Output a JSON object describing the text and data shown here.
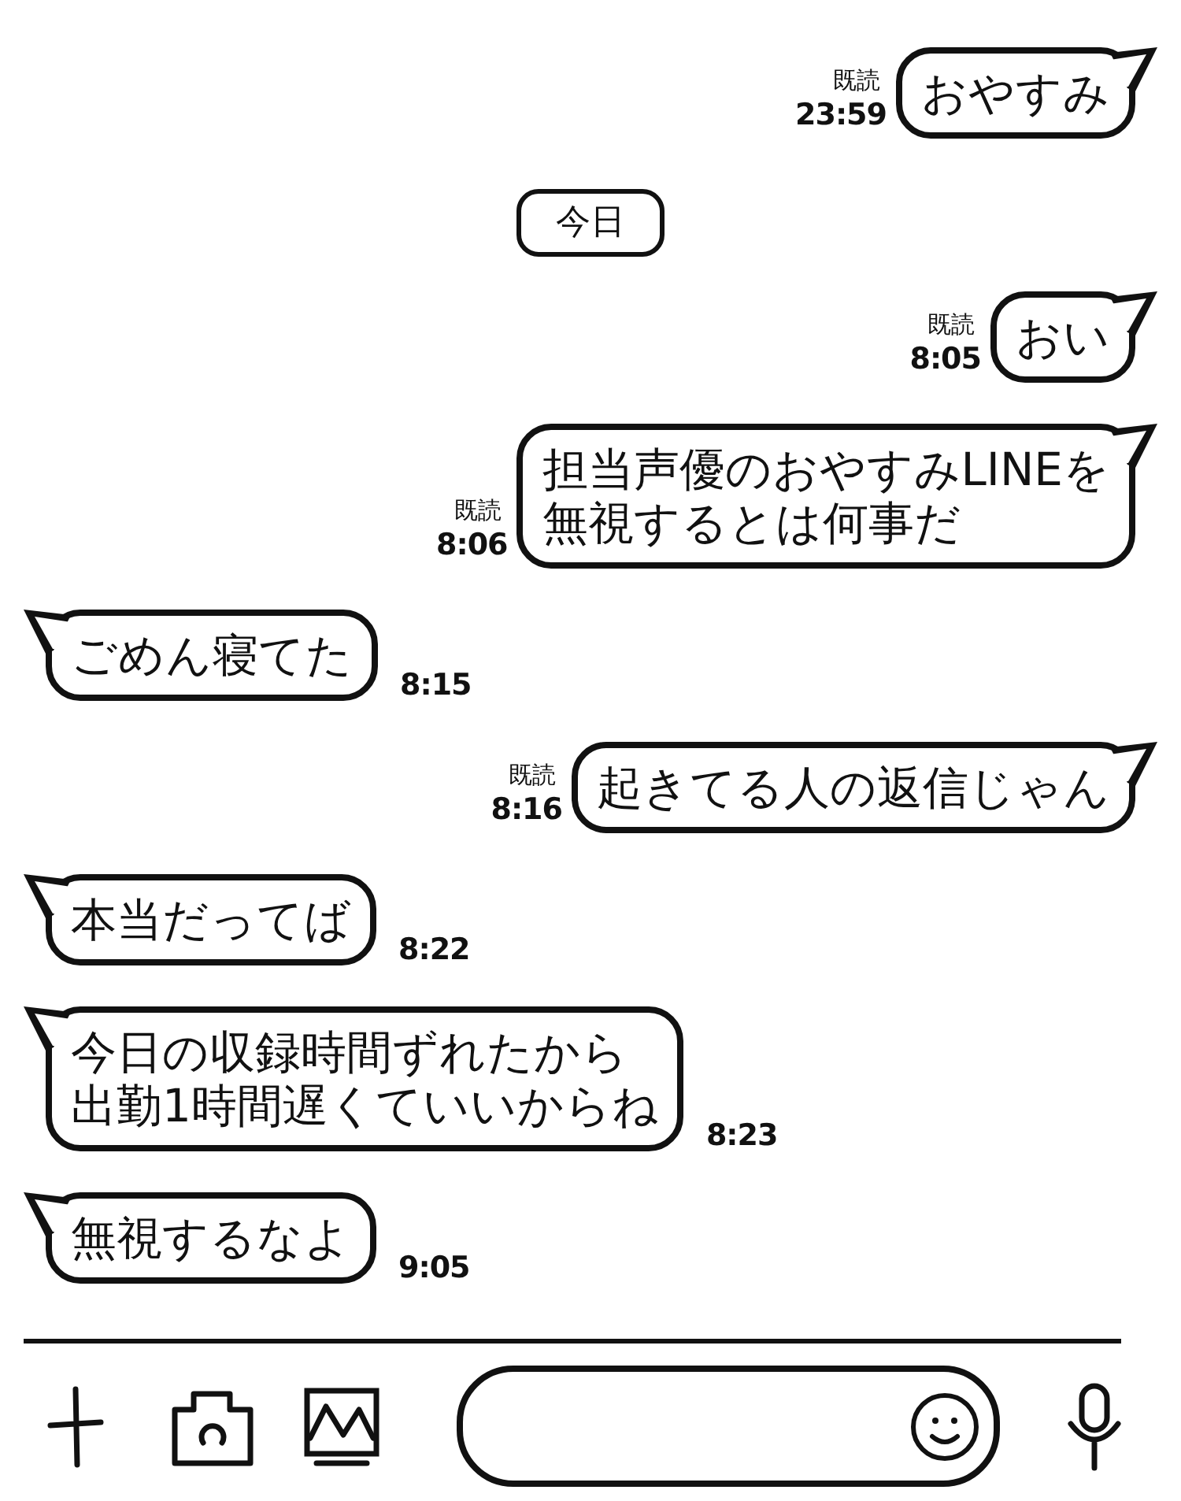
{
  "messages": [
    {
      "kind": "outgoing",
      "lines": [
        "おやすみ"
      ],
      "read_label": "既読",
      "time": "23:59"
    },
    {
      "kind": "date",
      "text": "今日"
    },
    {
      "kind": "outgoing",
      "lines": [
        "おい"
      ],
      "read_label": "既読",
      "time": "8:05"
    },
    {
      "kind": "outgoing",
      "lines": [
        "担当声優のおやすみLINEを",
        "無視するとは何事だ"
      ],
      "read_label": "既読",
      "time": "8:06"
    },
    {
      "kind": "incoming",
      "lines": [
        "ごめん寝てた"
      ],
      "time": "8:15"
    },
    {
      "kind": "outgoing",
      "lines": [
        "起きてる人の返信じゃん"
      ],
      "read_label": "既読",
      "time": "8:16"
    },
    {
      "kind": "incoming",
      "lines": [
        "本当だってば"
      ],
      "time": "8:22"
    },
    {
      "kind": "incoming",
      "lines": [
        "今日の収録時間ずれたから",
        "出勤1時間遅くていいからね"
      ],
      "time": "8:23"
    },
    {
      "kind": "incoming",
      "lines": [
        "無視するなよ"
      ],
      "time": "9:05"
    }
  ]
}
